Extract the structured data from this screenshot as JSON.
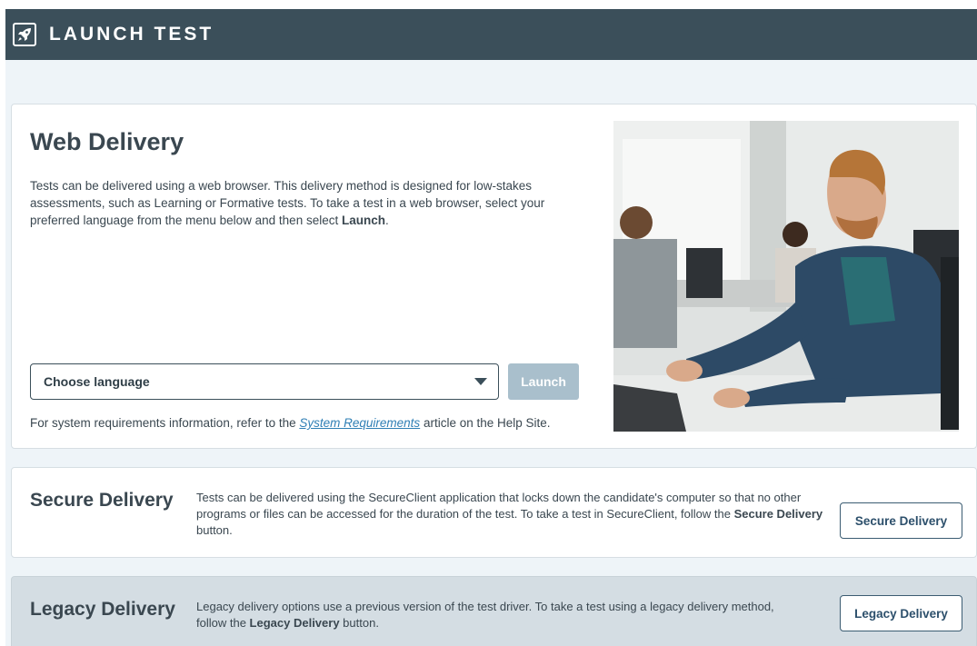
{
  "header": {
    "title": "LAUNCH TEST",
    "logo_icon": "rocket-icon"
  },
  "web": {
    "title": "Web Delivery",
    "desc_text": "Tests can be delivered using a web browser. This delivery method is designed for low-stakes assessments, such as Learning or Formative tests. To take a test in a web browser, select your preferred language from the menu below and then select ",
    "desc_bold": "Launch",
    "desc_end": ".",
    "select_value": "Choose language",
    "launch_label": "Launch",
    "sysreq_before": "For system requirements information, refer to the ",
    "sysreq_link": "System Requirements",
    "sysreq_after": " article on the Help Site."
  },
  "secure": {
    "title": "Secure Delivery",
    "desc_text": "Tests can be delivered using the SecureClient application that locks down the candidate's computer so that no other programs or files can be accessed for the duration of the test. To take a test in SecureClient, follow the ",
    "desc_bold": "Secure Delivery",
    "desc_end": " button.",
    "button_label": "Secure Delivery"
  },
  "legacy": {
    "title": "Legacy Delivery",
    "desc_text": "Legacy delivery options use a previous version of the test driver. To take a test using a legacy delivery method, follow the ",
    "desc_bold": "Legacy Delivery",
    "desc_end": " button.",
    "button_label": "Legacy Delivery"
  },
  "colors": {
    "header_bg": "#3b4f5a",
    "page_bg": "#eef4f8",
    "launch_disabled": "#a9bfcc",
    "link": "#2f7fb5"
  }
}
